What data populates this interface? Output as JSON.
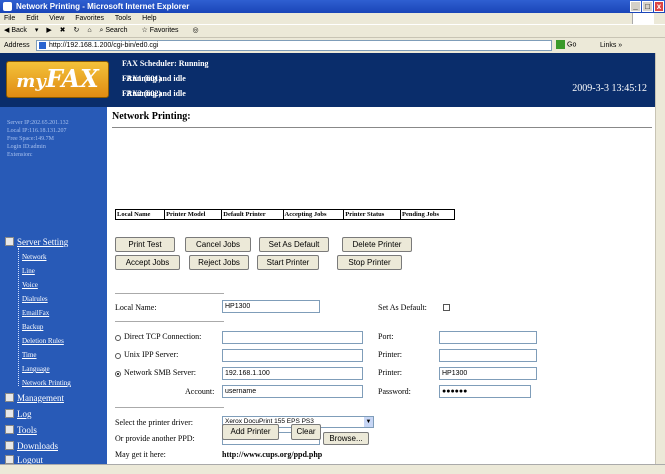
{
  "window": {
    "title": "Network Printing - Microsoft Internet Explorer"
  },
  "menu": [
    "File",
    "Edit",
    "View",
    "Favorites",
    "Tools",
    "Help"
  ],
  "toolbar": {
    "back": "Back",
    "search": "Search",
    "favorites": "Favorites"
  },
  "addressbar": {
    "label": "Address",
    "url": "http://192.168.1.200/cgi-bin/ed0.cgi",
    "go": "Go",
    "links": "Links"
  },
  "header": {
    "logo_my": "my",
    "logo_fax": "FAX",
    "scheduler": "FAX Scheduler: Running",
    "fax1_label": "FAX1 (601)",
    "fax1_status": ": Running and idle",
    "fax2_label": "FAX2 (602)",
    "fax2_status": ": Running and idle",
    "datetime": "2009-3-3 13:45:12"
  },
  "sidebar": {
    "server_ip": "Server IP:202.65.201.132",
    "local_ip": "Local IP:116.18.131.207",
    "free_space": "Free Space:149.7M",
    "login_id": "Login ID:admin",
    "extension": "Extension:",
    "server_setting": "Server Setting",
    "sub_items": [
      "Network",
      "Line",
      "Voice",
      "Dialrules",
      "EmailFax",
      "Backup",
      "Deletion Rules",
      "Time",
      "Language",
      "Network Printing"
    ],
    "management": "Management",
    "log": "Log",
    "tools": "Tools",
    "downloads": "Downloads",
    "logout": "Logout"
  },
  "main": {
    "title": "Network Printing:",
    "table_headers": [
      "Local Name",
      "Printer Model",
      "Default Printer",
      "Accepting Jobs",
      "Printer Status",
      "Pending Jobs"
    ],
    "buttons_row1": [
      "Print Test",
      "Cancel Jobs",
      "Set As Default",
      "Delete Printer"
    ],
    "buttons_row2": [
      "Accept Jobs",
      "Reject Jobs",
      "Start Printer",
      "Stop Printer"
    ],
    "local_name_label": "Local Name:",
    "local_name_value": "HP1300",
    "set_default_label": "Set As Default:",
    "direct_tcp_label": "Direct TCP Connection:",
    "port_label": "Port:",
    "unix_ipp_label": "Unix IPP Server:",
    "printer_label": "Printer:",
    "smb_label": "Network SMB Server:",
    "smb_server": "192.168.1.100",
    "smb_printer_label": "Printer:",
    "smb_printer": "HP1300",
    "account_label": "Account:",
    "account_value": "username",
    "password_label": "Password:",
    "password_value": "●●●●●●",
    "driver_label": "Select the printer driver:",
    "driver_value": "Xerox DocuPrint 155 EPS PS3",
    "ppd_label": "Or provide another PPD:",
    "browse": "Browse...",
    "get_it_label": "May get it here:",
    "cups_link": "http://www.cups.org/ppd.php",
    "add_printer": "Add Printer",
    "clear": "Clear"
  }
}
